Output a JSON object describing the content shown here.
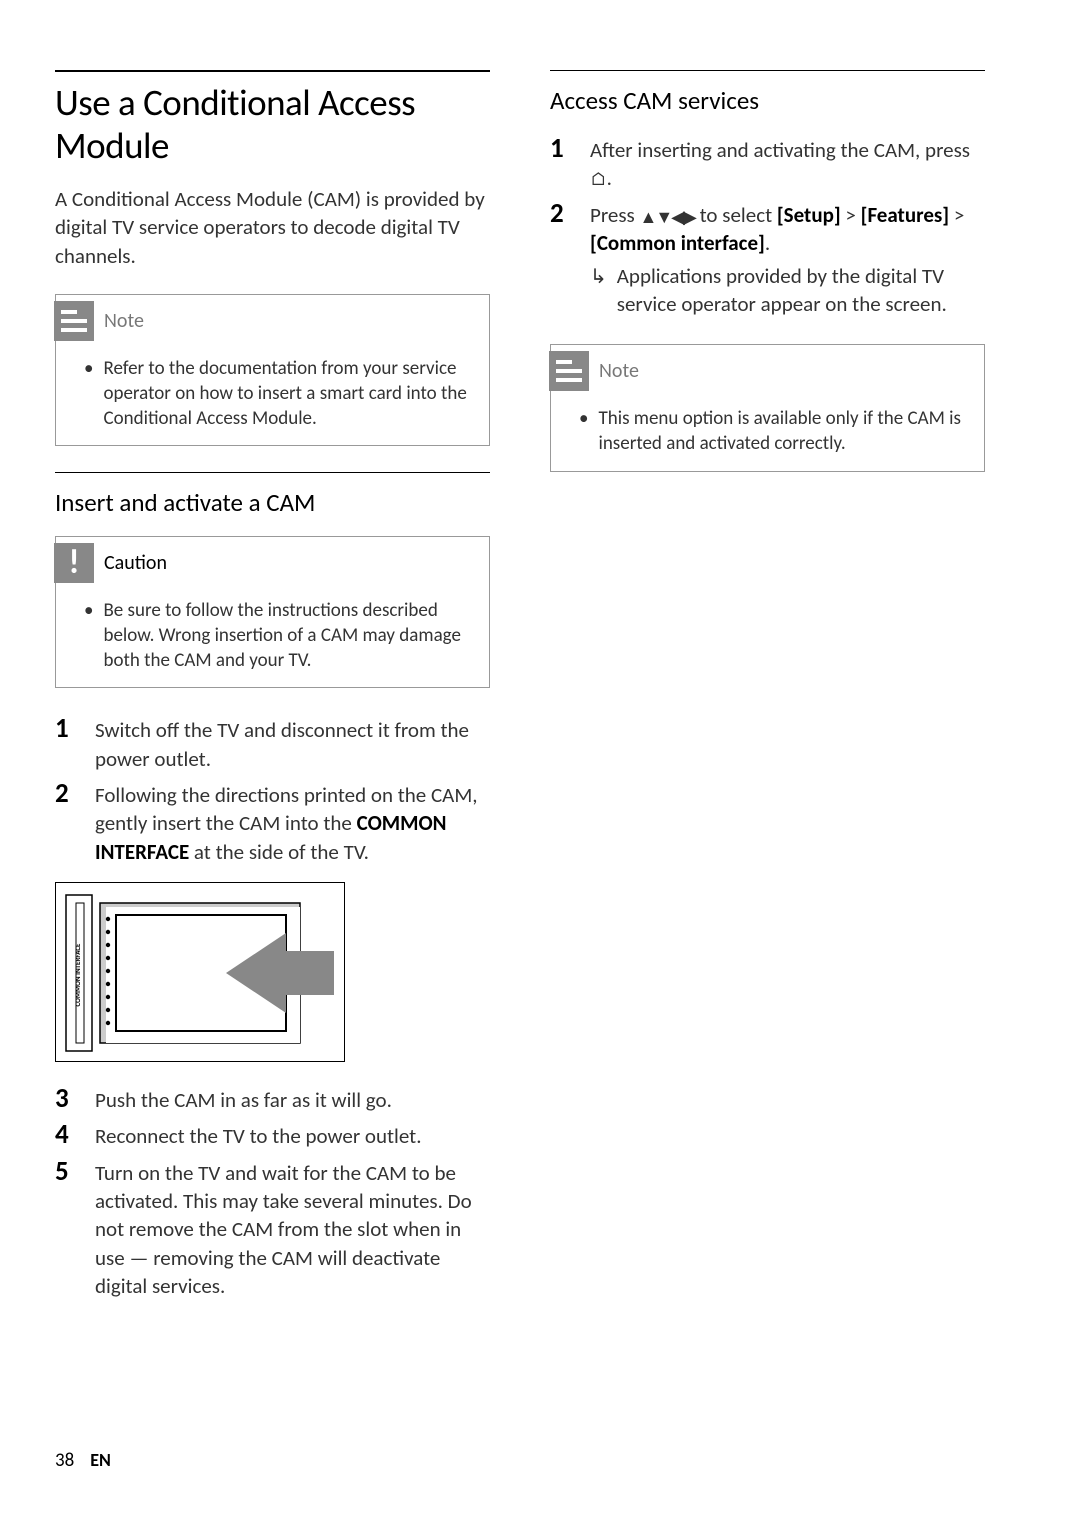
{
  "left": {
    "heading": "Use a Conditional Access Module",
    "intro": "A Conditional Access Module (CAM) is provided by digital TV service operators to decode digital TV channels.",
    "note1": {
      "label": "Note",
      "body": "Refer to the documentation from your service operator on how to insert a smart card into the Conditional Access Module."
    },
    "subheading": "Insert and activate a CAM",
    "caution": {
      "label": "Caution",
      "body": "Be sure to follow the instructions described below. Wrong insertion of a CAM may damage both the CAM and your TV."
    },
    "steps": {
      "s1": "Switch off the TV and disconnect it from the power outlet.",
      "s2_a": "Following the directions printed on the CAM, gently insert the CAM into the ",
      "s2_b": "COMMON INTERFACE",
      "s2_c": " at the side of the TV.",
      "s3": "Push the CAM in as far as it will go.",
      "s4": "Reconnect the TV to the power outlet.",
      "s5": "Turn on the TV and wait for the CAM to be activated. This may take several minutes. Do not remove the CAM from the slot when in use — removing the CAM will deactivate digital services."
    },
    "diagram_label": "COMMON INTERFACE"
  },
  "right": {
    "heading": "Access CAM services",
    "steps": {
      "s1_a": "After inserting and activating the CAM, press ",
      "s1_b": ".",
      "s2_a": "Press ",
      "s2_b": " to select ",
      "s2_setup": "[Setup]",
      "s2_gt": " > ",
      "s2_features": "[Features]",
      "s2_common": "[Common interface]",
      "s2_end": ".",
      "s2_sub": "Applications provided by the digital TV service operator appear on the screen."
    },
    "note2": {
      "label": "Note",
      "body": "This menu option is available only if the CAM is inserted and activated correctly."
    }
  },
  "footer": {
    "page": "38",
    "lang": "EN"
  }
}
